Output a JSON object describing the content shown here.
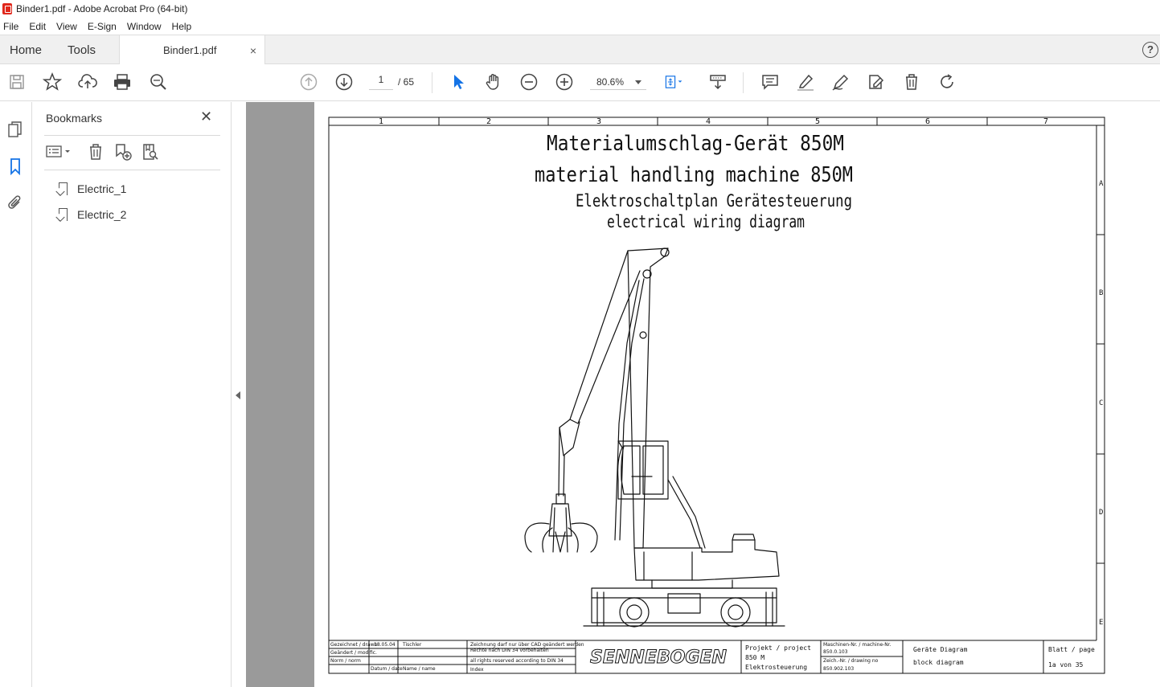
{
  "window": {
    "title": "Binder1.pdf - Adobe Acrobat Pro (64-bit)"
  },
  "menu": [
    "File",
    "Edit",
    "View",
    "E-Sign",
    "Window",
    "Help"
  ],
  "tabs": {
    "home": "Home",
    "tools": "Tools",
    "document": "Binder1.pdf",
    "close": "×",
    "help": "?"
  },
  "toolbar": {
    "page_current": "1",
    "page_total": "/ 65",
    "zoom": "80.6%"
  },
  "bookmarks": {
    "title": "Bookmarks",
    "close": "✕",
    "items": [
      {
        "label": "Electric_1"
      },
      {
        "label": "Electric_2"
      }
    ]
  },
  "drawing": {
    "columns": [
      "1",
      "2",
      "3",
      "4",
      "5",
      "6",
      "7"
    ],
    "rows": [
      "A",
      "B",
      "C",
      "D",
      "E"
    ],
    "title_de": "Materialumschlag-Gerät 850M",
    "title_en": "material handling machine 850M",
    "subtitle_de": "Elektroschaltplan Gerätesteuerung",
    "subtitle_en": "electrical wiring diagram",
    "titleblock": {
      "drawn_label": "Gezeichnet / drawn",
      "drawn_date": "18.05.04",
      "drawn_name": "Tischler",
      "checked_label": "Geändert / modific.",
      "norm_label": "Norm / norm",
      "date_label": "Datum / date",
      "name_label": "Name / name",
      "note1": "Zeichnung darf nur über CAD geändert werden",
      "note2": "Rechte nach DIN 34 vorbehalten",
      "note3": "all rights reserved according to DIN 34",
      "index_label": "Index",
      "logo": "SENNEBOGEN",
      "project_label": "Projekt / project",
      "project_value": "850 M",
      "project_desc": "Elektrosteuerung",
      "machine_label": "Maschinen-Nr. / machine-Nr.",
      "machine_value": "850.0.103",
      "drawing_label": "Zeich.-Nr. / drawing no",
      "drawing_value": "850.902.103",
      "diagram_de": "Geräte Diagram",
      "diagram_en": "block diagram",
      "sheet_label": "Blatt / page",
      "sheet_value": "1a von 35"
    }
  }
}
